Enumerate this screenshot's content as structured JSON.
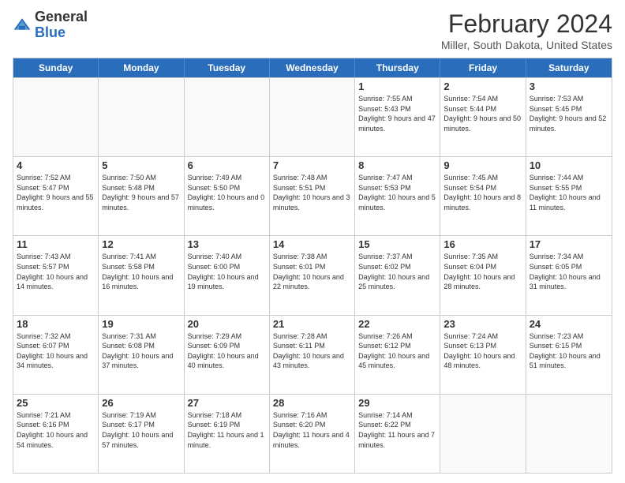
{
  "header": {
    "logo_general": "General",
    "logo_blue": "Blue",
    "title": "February 2024",
    "subtitle": "Miller, South Dakota, United States"
  },
  "days_of_week": [
    "Sunday",
    "Monday",
    "Tuesday",
    "Wednesday",
    "Thursday",
    "Friday",
    "Saturday"
  ],
  "weeks": [
    [
      {
        "day": "",
        "empty": true
      },
      {
        "day": "",
        "empty": true
      },
      {
        "day": "",
        "empty": true
      },
      {
        "day": "",
        "empty": true
      },
      {
        "day": "1",
        "sunrise": "7:55 AM",
        "sunset": "5:43 PM",
        "daylight": "9 hours and 47 minutes."
      },
      {
        "day": "2",
        "sunrise": "7:54 AM",
        "sunset": "5:44 PM",
        "daylight": "9 hours and 50 minutes."
      },
      {
        "day": "3",
        "sunrise": "7:53 AM",
        "sunset": "5:45 PM",
        "daylight": "9 hours and 52 minutes."
      }
    ],
    [
      {
        "day": "4",
        "sunrise": "7:52 AM",
        "sunset": "5:47 PM",
        "daylight": "9 hours and 55 minutes."
      },
      {
        "day": "5",
        "sunrise": "7:50 AM",
        "sunset": "5:48 PM",
        "daylight": "9 hours and 57 minutes."
      },
      {
        "day": "6",
        "sunrise": "7:49 AM",
        "sunset": "5:50 PM",
        "daylight": "10 hours and 0 minutes."
      },
      {
        "day": "7",
        "sunrise": "7:48 AM",
        "sunset": "5:51 PM",
        "daylight": "10 hours and 3 minutes."
      },
      {
        "day": "8",
        "sunrise": "7:47 AM",
        "sunset": "5:53 PM",
        "daylight": "10 hours and 5 minutes."
      },
      {
        "day": "9",
        "sunrise": "7:45 AM",
        "sunset": "5:54 PM",
        "daylight": "10 hours and 8 minutes."
      },
      {
        "day": "10",
        "sunrise": "7:44 AM",
        "sunset": "5:55 PM",
        "daylight": "10 hours and 11 minutes."
      }
    ],
    [
      {
        "day": "11",
        "sunrise": "7:43 AM",
        "sunset": "5:57 PM",
        "daylight": "10 hours and 14 minutes."
      },
      {
        "day": "12",
        "sunrise": "7:41 AM",
        "sunset": "5:58 PM",
        "daylight": "10 hours and 16 minutes."
      },
      {
        "day": "13",
        "sunrise": "7:40 AM",
        "sunset": "6:00 PM",
        "daylight": "10 hours and 19 minutes."
      },
      {
        "day": "14",
        "sunrise": "7:38 AM",
        "sunset": "6:01 PM",
        "daylight": "10 hours and 22 minutes."
      },
      {
        "day": "15",
        "sunrise": "7:37 AM",
        "sunset": "6:02 PM",
        "daylight": "10 hours and 25 minutes."
      },
      {
        "day": "16",
        "sunrise": "7:35 AM",
        "sunset": "6:04 PM",
        "daylight": "10 hours and 28 minutes."
      },
      {
        "day": "17",
        "sunrise": "7:34 AM",
        "sunset": "6:05 PM",
        "daylight": "10 hours and 31 minutes."
      }
    ],
    [
      {
        "day": "18",
        "sunrise": "7:32 AM",
        "sunset": "6:07 PM",
        "daylight": "10 hours and 34 minutes."
      },
      {
        "day": "19",
        "sunrise": "7:31 AM",
        "sunset": "6:08 PM",
        "daylight": "10 hours and 37 minutes."
      },
      {
        "day": "20",
        "sunrise": "7:29 AM",
        "sunset": "6:09 PM",
        "daylight": "10 hours and 40 minutes."
      },
      {
        "day": "21",
        "sunrise": "7:28 AM",
        "sunset": "6:11 PM",
        "daylight": "10 hours and 43 minutes."
      },
      {
        "day": "22",
        "sunrise": "7:26 AM",
        "sunset": "6:12 PM",
        "daylight": "10 hours and 45 minutes."
      },
      {
        "day": "23",
        "sunrise": "7:24 AM",
        "sunset": "6:13 PM",
        "daylight": "10 hours and 48 minutes."
      },
      {
        "day": "24",
        "sunrise": "7:23 AM",
        "sunset": "6:15 PM",
        "daylight": "10 hours and 51 minutes."
      }
    ],
    [
      {
        "day": "25",
        "sunrise": "7:21 AM",
        "sunset": "6:16 PM",
        "daylight": "10 hours and 54 minutes."
      },
      {
        "day": "26",
        "sunrise": "7:19 AM",
        "sunset": "6:17 PM",
        "daylight": "10 hours and 57 minutes."
      },
      {
        "day": "27",
        "sunrise": "7:18 AM",
        "sunset": "6:19 PM",
        "daylight": "11 hours and 1 minute."
      },
      {
        "day": "28",
        "sunrise": "7:16 AM",
        "sunset": "6:20 PM",
        "daylight": "11 hours and 4 minutes."
      },
      {
        "day": "29",
        "sunrise": "7:14 AM",
        "sunset": "6:22 PM",
        "daylight": "11 hours and 7 minutes."
      },
      {
        "day": "",
        "empty": true
      },
      {
        "day": "",
        "empty": true
      }
    ]
  ]
}
